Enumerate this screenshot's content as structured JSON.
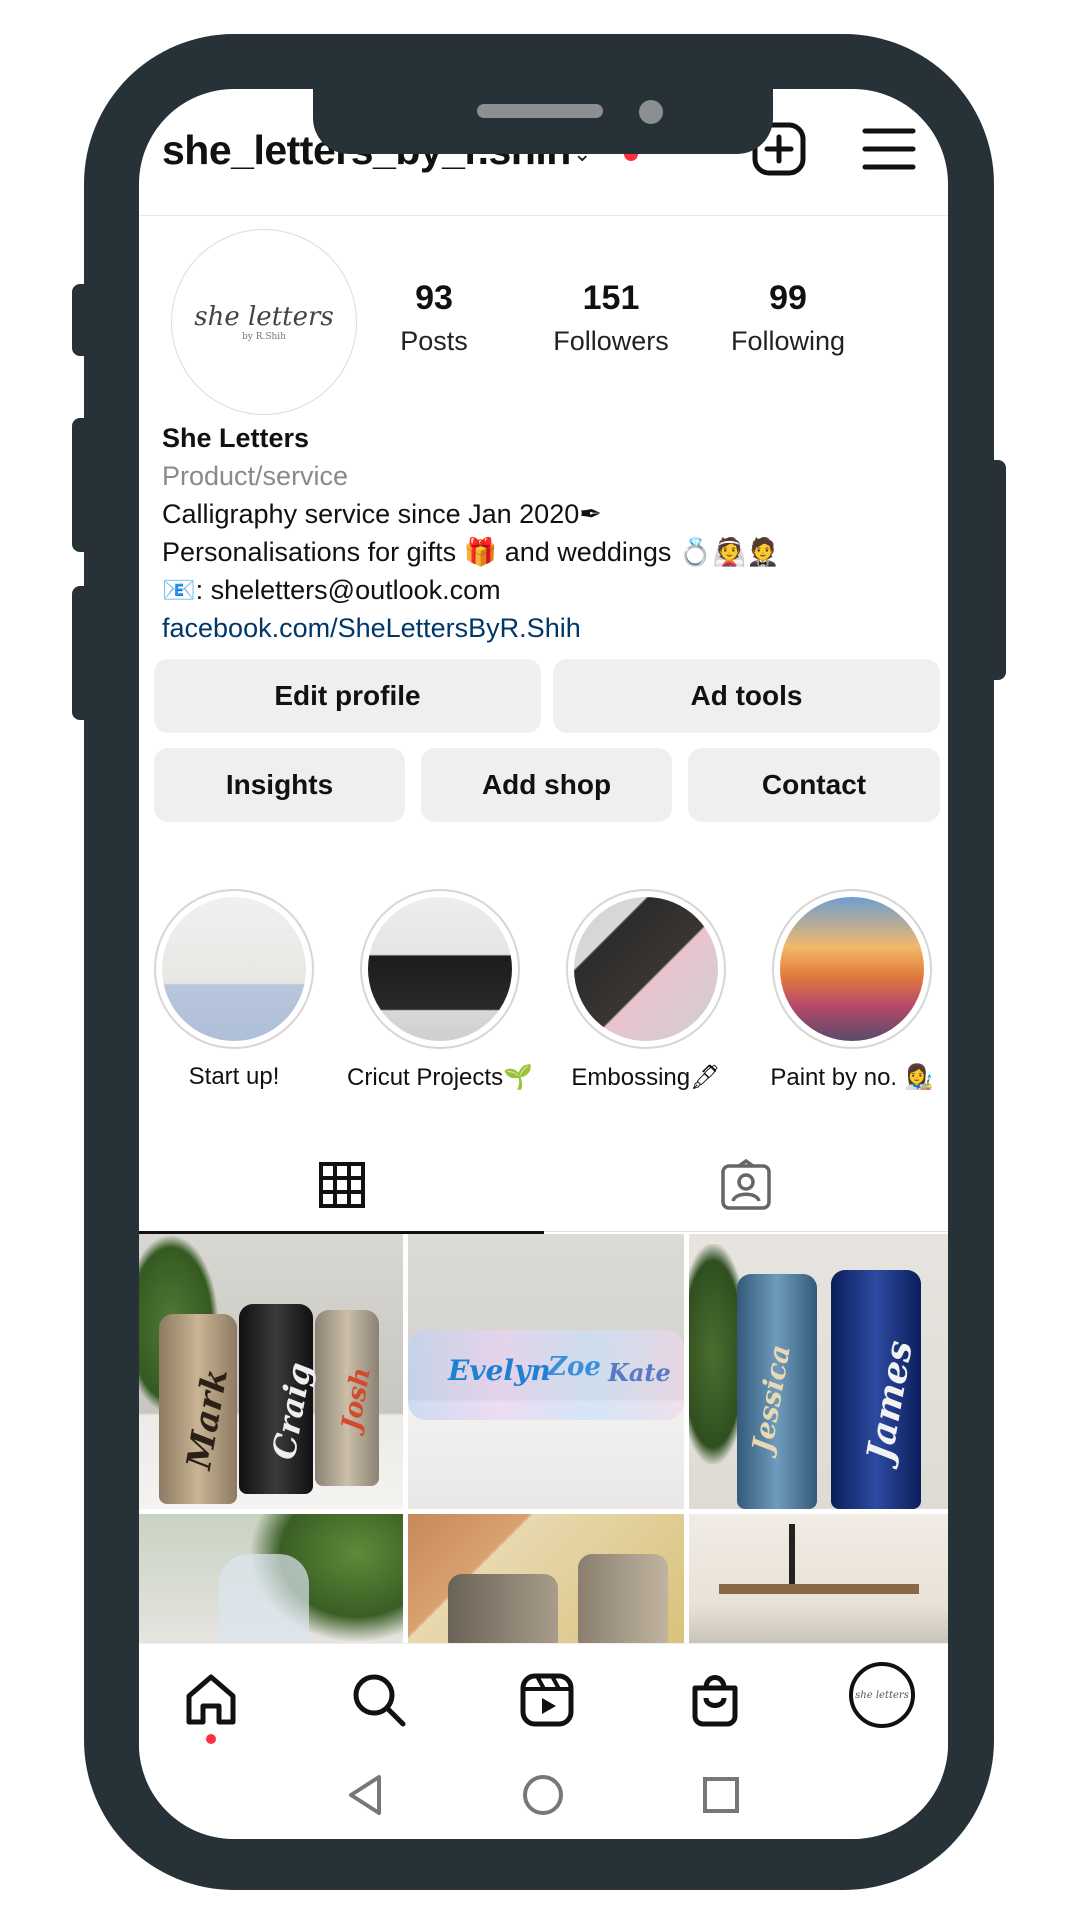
{
  "header": {
    "username": "she_letters_by_r.shih"
  },
  "profile": {
    "avatar_logo": "she letters",
    "avatar_sub": "by R.Shih",
    "stats": [
      {
        "value": "93",
        "label": "Posts"
      },
      {
        "value": "151",
        "label": "Followers"
      },
      {
        "value": "99",
        "label": "Following"
      }
    ],
    "name": "She Letters",
    "category": "Product/service",
    "bio_lines": [
      "Calligraphy service since Jan 2020✒",
      "Personalisations for gifts 🎁 and weddings 💍👰🤵",
      "📧: sheletters@outlook.com"
    ],
    "link": "facebook.com/SheLettersByR.Shih"
  },
  "buttons": {
    "edit_profile": "Edit profile",
    "ad_tools": "Ad tools",
    "insights": "Insights",
    "add_shop": "Add shop",
    "contact": "Contact"
  },
  "highlights": [
    {
      "label": "Start up!"
    },
    {
      "label": "Cricut Projects🌱"
    },
    {
      "label": "Embossing🖋"
    },
    {
      "label": "Paint by no. 👩‍🎨"
    }
  ],
  "posts": {
    "names_1": [
      "Mark",
      "Craig",
      "Josh"
    ],
    "names_2": [
      "Evelyn",
      "Zoe",
      "Kate"
    ],
    "names_3": [
      "Jessica",
      "James"
    ]
  },
  "colors": {
    "frame": "#263238",
    "link": "#00376b",
    "notification": "#ff3040"
  }
}
